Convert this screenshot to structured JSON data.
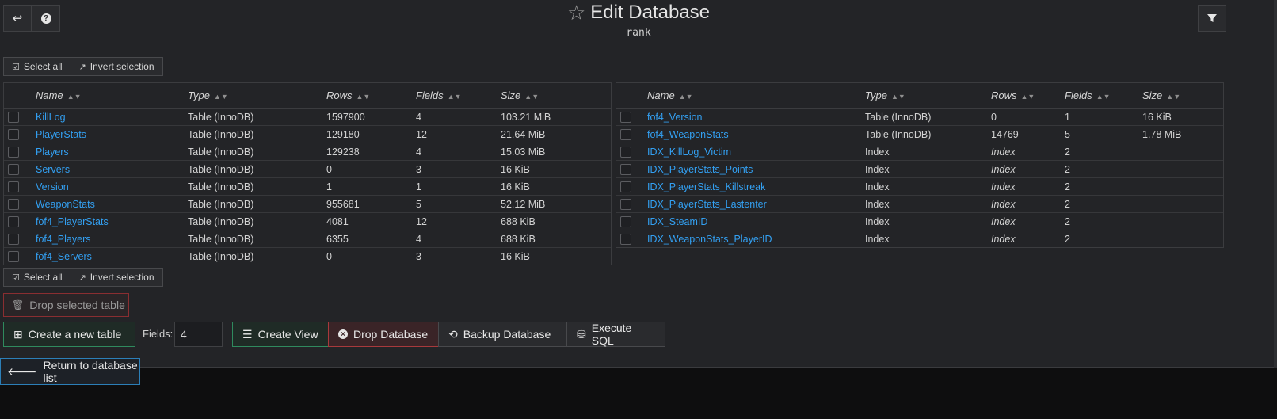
{
  "header": {
    "title": "Edit Database",
    "subtitle": "rank",
    "back_icon": "↩",
    "help_icon": "?",
    "filter_icon": "filter-icon"
  },
  "selection": {
    "select_all": "Select all",
    "invert": "Invert selection"
  },
  "columns": {
    "name": "Name",
    "type": "Type",
    "rows": "Rows",
    "fields": "Fields",
    "size": "Size"
  },
  "left_table": [
    {
      "name": "KillLog",
      "type": "Table (InnoDB)",
      "rows": "1597900",
      "fields": "4",
      "size": "103.21 MiB"
    },
    {
      "name": "PlayerStats",
      "type": "Table (InnoDB)",
      "rows": "129180",
      "fields": "12",
      "size": "21.64 MiB"
    },
    {
      "name": "Players",
      "type": "Table (InnoDB)",
      "rows": "129238",
      "fields": "4",
      "size": "15.03 MiB"
    },
    {
      "name": "Servers",
      "type": "Table (InnoDB)",
      "rows": "0",
      "fields": "3",
      "size": "16 KiB"
    },
    {
      "name": "Version",
      "type": "Table (InnoDB)",
      "rows": "1",
      "fields": "1",
      "size": "16 KiB"
    },
    {
      "name": "WeaponStats",
      "type": "Table (InnoDB)",
      "rows": "955681",
      "fields": "5",
      "size": "52.12 MiB"
    },
    {
      "name": "fof4_PlayerStats",
      "type": "Table (InnoDB)",
      "rows": "4081",
      "fields": "12",
      "size": "688 KiB"
    },
    {
      "name": "fof4_Players",
      "type": "Table (InnoDB)",
      "rows": "6355",
      "fields": "4",
      "size": "688 KiB"
    },
    {
      "name": "fof4_Servers",
      "type": "Table (InnoDB)",
      "rows": "0",
      "fields": "3",
      "size": "16 KiB"
    }
  ],
  "right_table": [
    {
      "name": "fof4_Version",
      "type": "Table (InnoDB)",
      "rows": "0",
      "fields": "1",
      "size": "16 KiB"
    },
    {
      "name": "fof4_WeaponStats",
      "type": "Table (InnoDB)",
      "rows": "14769",
      "fields": "5",
      "size": "1.78 MiB"
    },
    {
      "name": "IDX_KillLog_Victim",
      "type": "Index",
      "rows": "Index",
      "fields": "2",
      "size": ""
    },
    {
      "name": "IDX_PlayerStats_Points",
      "type": "Index",
      "rows": "Index",
      "fields": "2",
      "size": ""
    },
    {
      "name": "IDX_PlayerStats_Killstreak",
      "type": "Index",
      "rows": "Index",
      "fields": "2",
      "size": ""
    },
    {
      "name": "IDX_PlayerStats_Lastenter",
      "type": "Index",
      "rows": "Index",
      "fields": "2",
      "size": ""
    },
    {
      "name": "IDX_SteamID",
      "type": "Index",
      "rows": "Index",
      "fields": "2",
      "size": ""
    },
    {
      "name": "IDX_WeaponStats_PlayerID",
      "type": "Index",
      "rows": "Index",
      "fields": "2",
      "size": ""
    }
  ],
  "actions": {
    "drop_selected": "Drop selected table",
    "create_table": "Create a new table",
    "fields_label": "Fields:",
    "fields_value": "4",
    "create_view": "Create View",
    "drop_database": "Drop Database",
    "backup_database": "Backup Database",
    "execute_sql": "Execute SQL",
    "return": "Return to database list"
  }
}
